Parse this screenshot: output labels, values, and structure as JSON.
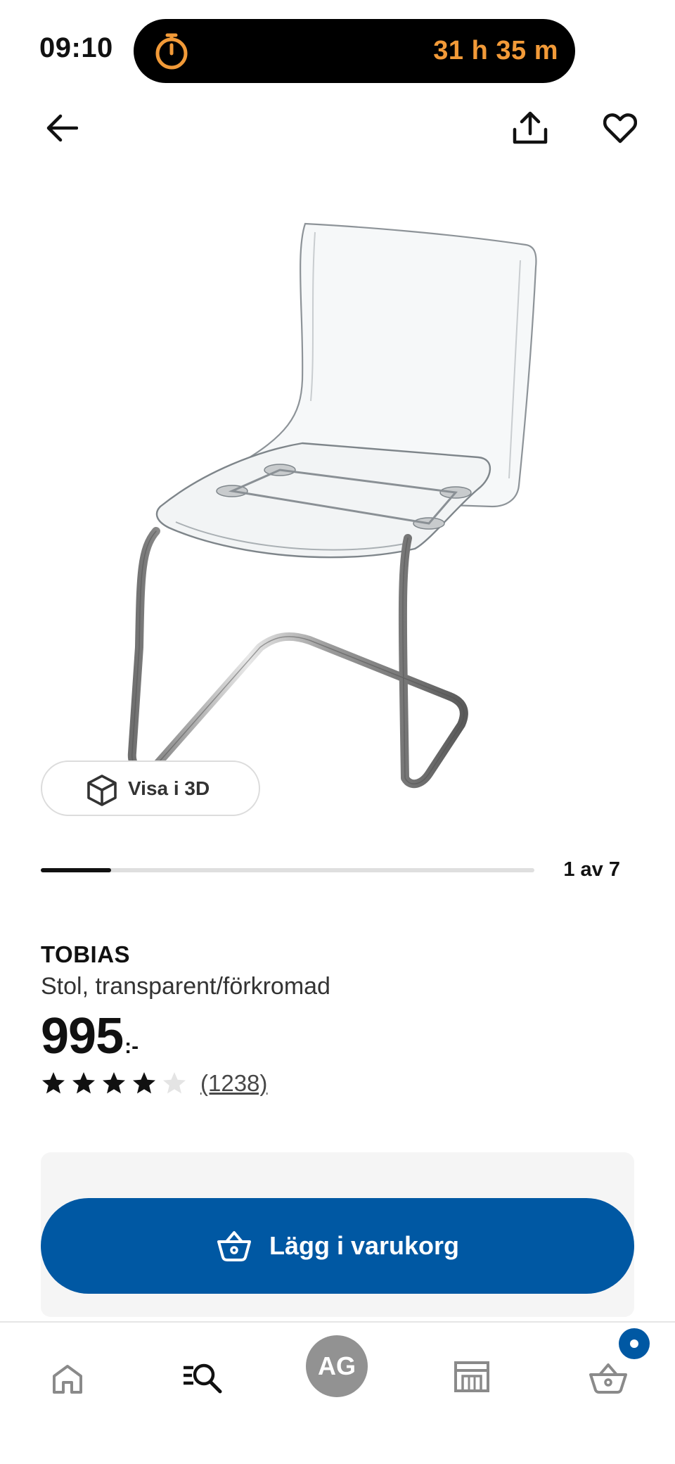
{
  "status_bar": {
    "time": "09:10",
    "activity_timer": "31 h 35 m",
    "activity_icon": "stopwatch-icon",
    "accent_color": "#f29a38"
  },
  "top_bar": {
    "back_icon": "arrow-left-icon",
    "share_icon": "share-icon",
    "favorite_icon": "heart-icon"
  },
  "gallery": {
    "image_alt": "TOBIAS Stol, transparent/förkromad",
    "view3d_label": "Visa i 3D",
    "counter": "1 av 7",
    "progress": 0.14285
  },
  "product": {
    "name": "TOBIAS",
    "description": "Stol, transparent/förkromad",
    "price": "995",
    "price_suffix": ":-",
    "rating": 4,
    "rating_max": 5,
    "review_count": "(1238)"
  },
  "cart": {
    "button_label": "Lägg i varukorg",
    "button_color": "#0058a3"
  },
  "bottom_nav": {
    "items": [
      "home-icon",
      "search-icon",
      "profile-avatar",
      "stores-icon",
      "cart-icon"
    ],
    "profile_initials": "AG",
    "cart_badge_color": "#0058a3"
  }
}
